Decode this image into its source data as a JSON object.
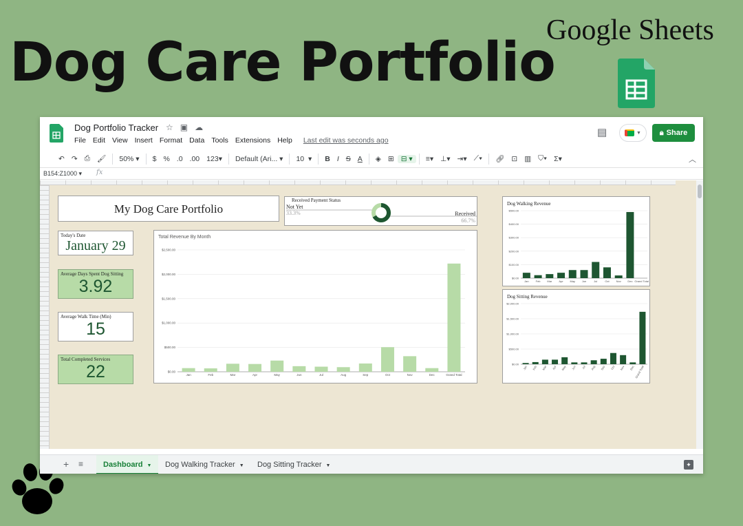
{
  "promo": {
    "title": "Dog Care Portfolio",
    "brand": "Google Sheets"
  },
  "titlebar": {
    "doc_title": "Dog Portfolio Tracker",
    "menu": [
      "File",
      "Edit",
      "View",
      "Insert",
      "Format",
      "Data",
      "Tools",
      "Extensions",
      "Help"
    ],
    "last_edit": "Last edit was seconds ago",
    "share_label": "Share"
  },
  "toolbar": {
    "zoom": "50%",
    "currency": "$",
    "percent": "%",
    "dec_decrease": ".0",
    "dec_increase": ".00",
    "more_formats": "123",
    "font": "Default (Ari...",
    "font_size": "10",
    "bold": "B",
    "italic": "I",
    "strike": "S",
    "text_color": "A"
  },
  "formula": {
    "namebox": "B154:Z1000",
    "fx": "fx"
  },
  "dashboard": {
    "title": "My Dog Care Portfolio",
    "todays_date_label": "Today's Date",
    "todays_date_value": "January 29",
    "avg_days_label": "Average Days Spent Dog Sitting",
    "avg_days_value": "3.92",
    "avg_walk_label": "Average Walk Time (Min)",
    "avg_walk_value": "15",
    "total_services_label": "Total Completed Services",
    "total_services_value": "22"
  },
  "payment": {
    "title": "Received Payment Status",
    "not_yet_label": "Not Yet",
    "not_yet_pct": "33.3%",
    "received_label": "Received",
    "received_pct": "66.7%"
  },
  "colors": {
    "dark_green": "#1e5631",
    "light_green": "#b7dba7",
    "share_green": "#1e8e3e",
    "sheet_bg": "#ede6d3"
  },
  "chart_data": [
    {
      "type": "bar",
      "title": "Total Revenue By Month",
      "categories": [
        "Jan",
        "Feb",
        "Mar",
        "Apr",
        "May",
        "Jun",
        "Jul",
        "Aug",
        "Sep",
        "Oct",
        "Nov",
        "Dec",
        "Grand Total"
      ],
      "values": [
        75,
        70,
        165,
        160,
        230,
        115,
        105,
        95,
        170,
        505,
        320,
        75,
        2220
      ],
      "ylim": [
        0,
        2500
      ],
      "yticks": [
        "$0.00",
        "$500.00",
        "$1,000.00",
        "$1,500.00",
        "$2,000.00",
        "$2,500.00"
      ],
      "color": "#b7dba7",
      "grid": true
    },
    {
      "type": "bar",
      "title": "Dog Walking Revenue",
      "categories": [
        "Jan",
        "Feb",
        "Mar",
        "Apr",
        "May",
        "Jun",
        "Jul",
        "Oct",
        "Nov",
        "Dec",
        "Grand Total"
      ],
      "values": [
        40,
        22,
        30,
        40,
        60,
        60,
        120,
        80,
        20,
        490
      ],
      "ylim": [
        0,
        500
      ],
      "yticks": [
        "$0.00",
        "$100.00",
        "$200.00",
        "$300.00",
        "$400.00",
        "$500.00"
      ],
      "color": "#1e5631",
      "grid": true
    },
    {
      "type": "bar",
      "title": "Dog Sitting Revenue",
      "categories": [
        "Jan",
        "Feb",
        "Mar",
        "Apr",
        "May",
        "Jun",
        "Jul",
        "Aug",
        "Sep",
        "Oct",
        "Nov",
        "Dec",
        "Grand Total"
      ],
      "values": [
        40,
        70,
        150,
        150,
        230,
        60,
        60,
        130,
        180,
        370,
        300,
        60,
        1730
      ],
      "ylim": [
        0,
        2000
      ],
      "yticks": [
        "$0.00",
        "$500.00",
        "$1,000.00",
        "$1,500.00",
        "$2,000.00"
      ],
      "color": "#1e5631",
      "grid": true
    }
  ],
  "tabs": [
    {
      "label": "Dashboard",
      "active": true
    },
    {
      "label": "Dog Walking Tracker",
      "active": false
    },
    {
      "label": "Dog Sitting Tracker",
      "active": false
    }
  ]
}
